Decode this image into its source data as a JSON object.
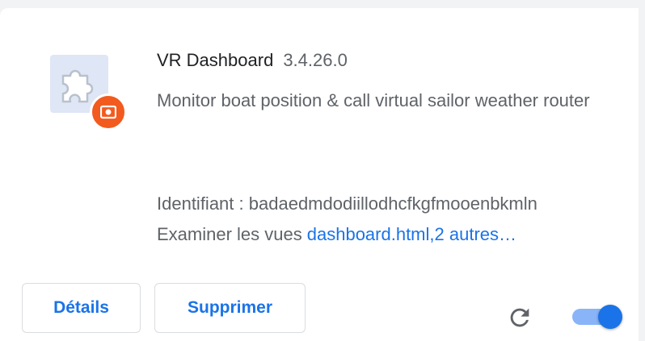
{
  "extension": {
    "name": "VR Dashboard",
    "version": "3.4.26.0",
    "description": "Monitor boat position & call virtual sailor weather router",
    "id_label": "Identifiant :",
    "id_value": "badaedmdodiillodhcfkgfmooenbkmln",
    "views_label": "Examiner les vues",
    "views_link": "dashboard.html,2 autres…",
    "icon": "puzzle-piece-icon",
    "badge_icon": "camera-record-icon",
    "enabled": true
  },
  "actions": {
    "details_label": "Détails",
    "remove_label": "Supprimer",
    "reload_icon": "reload-icon"
  },
  "colors": {
    "accent": "#1a73e8",
    "accent_light": "#8ab4f8",
    "badge": "#f25a1e",
    "icon_tile": "#dfe6f5",
    "text_primary": "#202124",
    "text_secondary": "#5f6368"
  }
}
